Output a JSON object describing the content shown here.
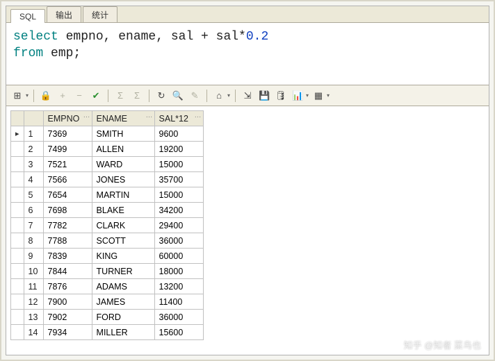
{
  "tabs": {
    "sql": "SQL",
    "output": "输出",
    "stats": "统计"
  },
  "sql": {
    "kw_select": "select",
    "cols": " empno, ename, sal + sal*",
    "factor": "0.2",
    "kw_from": "from",
    "tbl": " emp;"
  },
  "toolbar_icons": {
    "grid": "⊞",
    "lock": "🔒",
    "plus": "+",
    "minus": "−",
    "check": "✔",
    "sigma1": "Σ",
    "sigma2": "Σ",
    "refresh": "↻",
    "find": "🔍",
    "edit": "✎",
    "home": "⌂",
    "export": "⇲",
    "save": "💾",
    "db": "🛢",
    "chart": "📊",
    "table": "▦"
  },
  "columns": {
    "empno": "EMPNO",
    "ename": "ENAME",
    "sal": "SAL*12"
  },
  "rows": [
    {
      "n": 1,
      "empno": 7369,
      "ename": "SMITH",
      "sal": 9600
    },
    {
      "n": 2,
      "empno": 7499,
      "ename": "ALLEN",
      "sal": 19200
    },
    {
      "n": 3,
      "empno": 7521,
      "ename": "WARD",
      "sal": 15000
    },
    {
      "n": 4,
      "empno": 7566,
      "ename": "JONES",
      "sal": 35700
    },
    {
      "n": 5,
      "empno": 7654,
      "ename": "MARTIN",
      "sal": 15000
    },
    {
      "n": 6,
      "empno": 7698,
      "ename": "BLAKE",
      "sal": 34200
    },
    {
      "n": 7,
      "empno": 7782,
      "ename": "CLARK",
      "sal": 29400
    },
    {
      "n": 8,
      "empno": 7788,
      "ename": "SCOTT",
      "sal": 36000
    },
    {
      "n": 9,
      "empno": 7839,
      "ename": "KING",
      "sal": 60000
    },
    {
      "n": 10,
      "empno": 7844,
      "ename": "TURNER",
      "sal": 18000
    },
    {
      "n": 11,
      "empno": 7876,
      "ename": "ADAMS",
      "sal": 13200
    },
    {
      "n": 12,
      "empno": 7900,
      "ename": "JAMES",
      "sal": 11400
    },
    {
      "n": 13,
      "empno": 7902,
      "ename": "FORD",
      "sal": 36000
    },
    {
      "n": 14,
      "empno": 7934,
      "ename": "MILLER",
      "sal": 15600
    }
  ],
  "current_row": 1,
  "watermark": "知乎 @知者 菜鸟也"
}
